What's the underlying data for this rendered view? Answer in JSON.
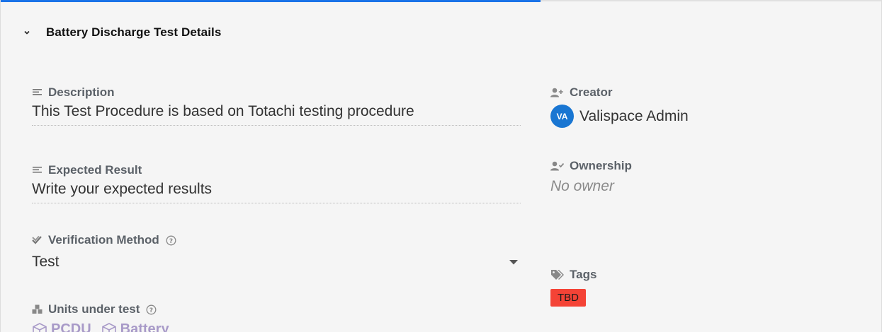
{
  "progress": {
    "fraction": 0.613
  },
  "section": {
    "title": "Battery Discharge Test Details"
  },
  "description": {
    "label": "Description",
    "value": "This Test Procedure is based on Totachi testing procedure"
  },
  "expected_result": {
    "label": "Expected Result",
    "value": "Write your expected results"
  },
  "verification_method": {
    "label": "Verification Method",
    "value": "Test"
  },
  "units_under_test": {
    "label": "Units under test",
    "units": [
      "PCDU",
      "Battery"
    ]
  },
  "creator": {
    "label": "Creator",
    "avatar_initials": "VA",
    "name": "Valispace Admin"
  },
  "ownership": {
    "label": "Ownership",
    "value": "No owner"
  },
  "tags": {
    "label": "Tags",
    "items": [
      "TBD"
    ]
  },
  "colors": {
    "accent": "#1a73e8",
    "avatar": "#1976d2",
    "tag_tbd": "#f44336",
    "unit_chip": "#a89ac8"
  },
  "icons": [
    "chevron-down-icon",
    "text-lines-icon",
    "double-check-icon",
    "help-icon",
    "cubes-icon",
    "add-person-icon",
    "person-check-icon",
    "tags-icon",
    "dropdown-arrow-icon",
    "cube-icon"
  ]
}
